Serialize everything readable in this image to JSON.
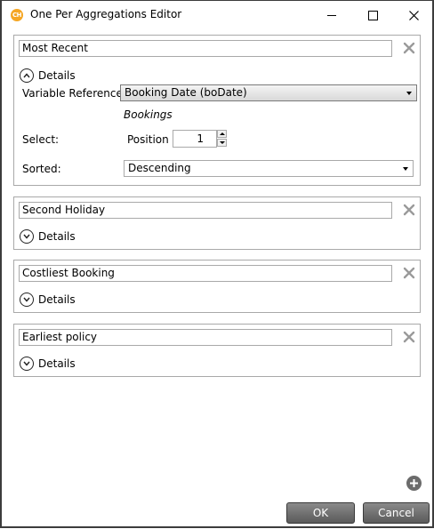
{
  "window": {
    "icon_text": "CH",
    "title": "One Per Aggregations Editor"
  },
  "aggregations": [
    {
      "name": "Most Recent",
      "details_label": "Details",
      "expanded": true,
      "variable_reference_label": "Variable Reference:",
      "variable_reference_value": "Booking Date (boDate)",
      "table_name": "Bookings",
      "select_label": "Select:",
      "position_label": "Position",
      "position_value": "1",
      "sorted_label": "Sorted:",
      "sorted_value": "Descending"
    },
    {
      "name": "Second Holiday",
      "details_label": "Details",
      "expanded": false
    },
    {
      "name": "Costliest Booking",
      "details_label": "Details",
      "expanded": false
    },
    {
      "name": "Earliest policy",
      "details_label": "Details",
      "expanded": false
    }
  ],
  "buttons": {
    "ok": "OK",
    "cancel": "Cancel"
  },
  "colors": {
    "icon_orange": "#f5a623",
    "button_gray": "#6e6e6e",
    "border": "#a9a9a9"
  }
}
